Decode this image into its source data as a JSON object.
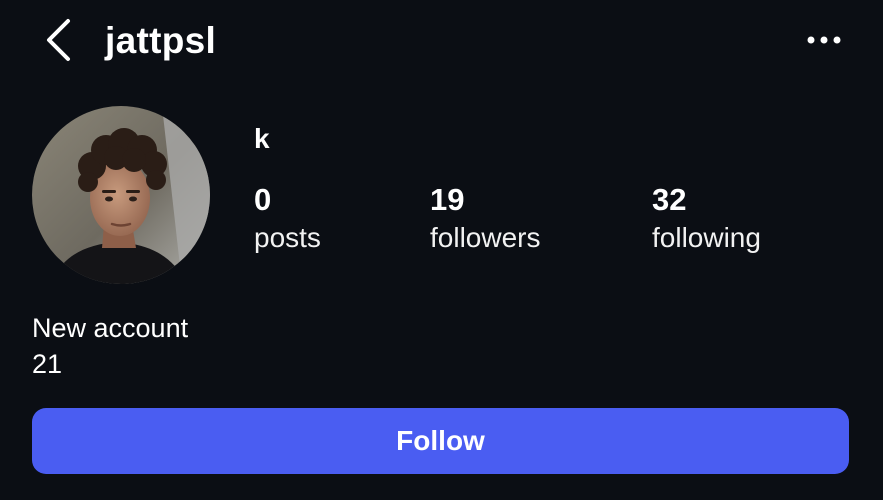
{
  "header": {
    "back_icon": "chevron-left-icon",
    "username": "jattpsl",
    "more_icon": "more-horizontal-icon"
  },
  "profile": {
    "display_name": "k",
    "avatar": "profile-photo",
    "stats": [
      {
        "count": "0",
        "label": "posts"
      },
      {
        "count": "19",
        "label": "followers"
      },
      {
        "count": "32",
        "label": "following"
      }
    ],
    "bio_lines": [
      "New account",
      "21"
    ]
  },
  "actions": {
    "follow_label": "Follow"
  },
  "colors": {
    "background": "#0b0e14",
    "follow_button": "#4a5df2",
    "text": "#ffffff"
  }
}
